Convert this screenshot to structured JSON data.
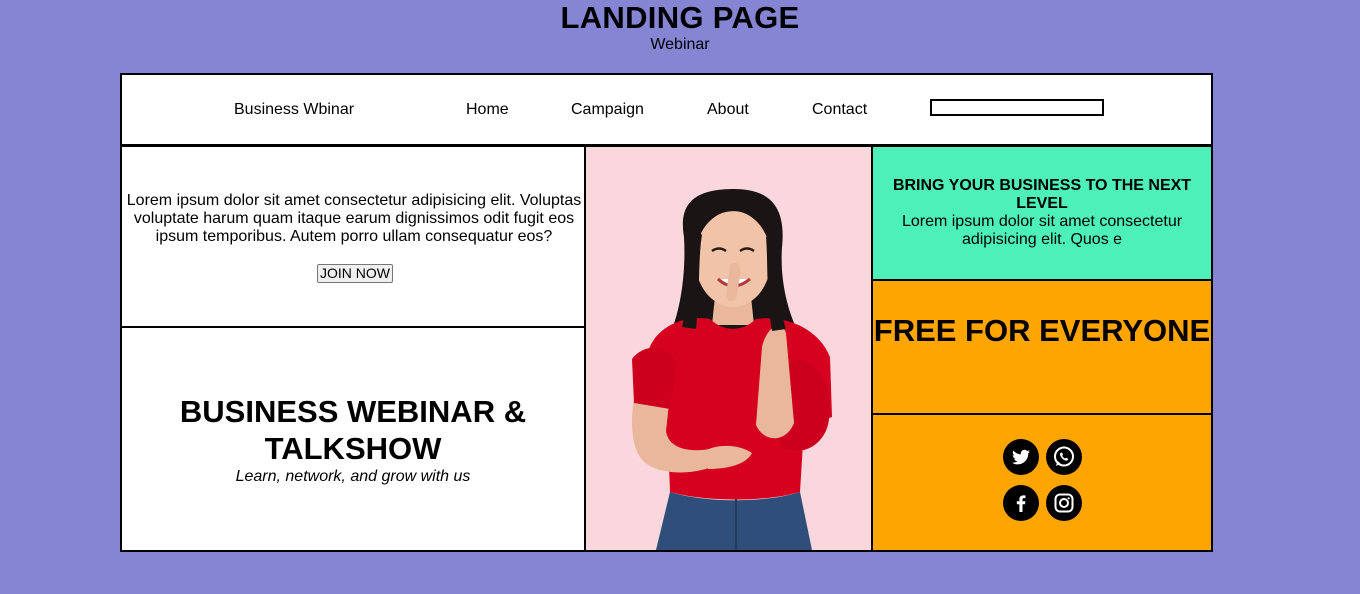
{
  "header": {
    "title": "LANDING PAGE",
    "subtitle": "Webinar"
  },
  "nav": {
    "brand": "Business Wbinar",
    "links": [
      "Home",
      "Campaign",
      "About",
      "Contact"
    ],
    "search_value": ""
  },
  "intro": {
    "text": "Lorem ipsum dolor sit amet consectetur adipisicing elit. Voluptas voluptate harum quam itaque earum dignissimos odit fugit eos ipsum temporibus. Autem porro ullam consequatur eos?",
    "button_label": "JOIN NOW"
  },
  "webinar": {
    "heading": "BUSINESS WEBINAR & TALKSHOW",
    "tagline": "Learn, network, and grow with us"
  },
  "next_level": {
    "heading": "BRING YOUR BUSINESS TO THE NEXT LEVEL",
    "text": "Lorem ipsum dolor sit amet consectetur adipisicing elit. Quos e"
  },
  "free": {
    "heading": "FREE FOR EVERYONE"
  },
  "social": {
    "icons": [
      "twitter-icon",
      "whatsapp-icon",
      "facebook-icon",
      "instagram-icon"
    ]
  },
  "colors": {
    "page_background": "#8585d4",
    "accent_green": "#4cf0b8",
    "accent_orange": "#ffa500",
    "photo_background": "#f9d7dd"
  }
}
